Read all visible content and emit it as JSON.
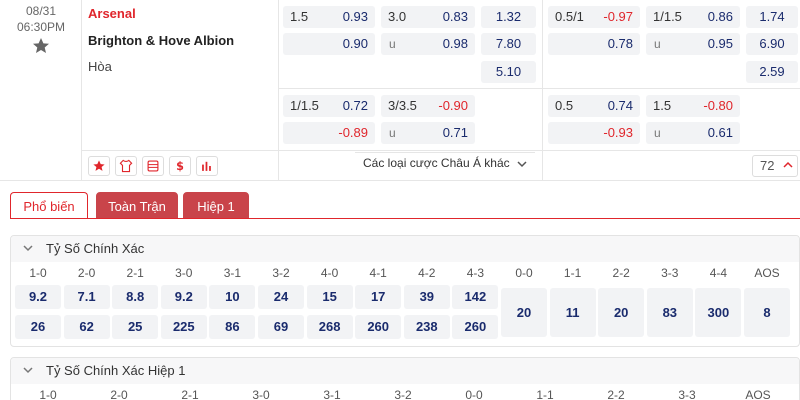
{
  "match": {
    "date": "08/31",
    "time": "06:30PM",
    "home_team": "Arsenal",
    "away_team": "Brighton & Hove Albion",
    "draw_label": "Hòa"
  },
  "odds_rows": {
    "row1": {
      "hdp_line": "1.5",
      "hdp_home": "0.93",
      "ou_line": "3.0",
      "ou_over": "0.83",
      "x12_home": "1.32",
      "h1_hdp_line": "0.5/1",
      "h1_hdp_home": "-0.97",
      "h1_ou_line": "1/1.5",
      "h1_ou_over": "0.86",
      "h1_x12_home": "1.74"
    },
    "row2": {
      "hdp_away": "0.90",
      "ou_u": "u",
      "ou_under": "0.98",
      "x12_away": "7.80",
      "h1_hdp_away": "0.78",
      "h1_ou_u": "u",
      "h1_ou_under": "0.95",
      "h1_x12_away": "6.90"
    },
    "row3": {
      "x12_draw": "5.10",
      "h1_x12_draw": "2.59"
    },
    "alt1": {
      "hdp_line": "1/1.5",
      "hdp_home": "0.72",
      "ou_line": "3/3.5",
      "ou_over": "-0.90",
      "h1_hdp_line": "0.5",
      "h1_hdp_home": "0.74",
      "h1_ou_line": "1.5",
      "h1_ou_over": "-0.80"
    },
    "alt2": {
      "hdp_away": "-0.89",
      "ou_u": "u",
      "ou_under": "0.71",
      "h1_hdp_away": "-0.93",
      "h1_ou_u": "u",
      "h1_ou_under": "0.61"
    }
  },
  "toolbar": {
    "icons": [
      "star-icon",
      "jersey-icon",
      "stats-icon",
      "dollar-icon",
      "chart-icon"
    ],
    "more_bets_label": "Các loại cược Châu Á khác",
    "market_count": "72"
  },
  "tabs": [
    {
      "label": "Phổ biến",
      "active": true
    },
    {
      "label": "Toàn Trận",
      "active": false
    },
    {
      "label": "Hiệp 1",
      "active": false
    }
  ],
  "correct_score": {
    "title": "Tỷ Số Chính Xác",
    "headers": [
      "1-0",
      "2-0",
      "2-1",
      "3-0",
      "3-1",
      "3-2",
      "4-0",
      "4-1",
      "4-2",
      "4-3",
      "0-0",
      "1-1",
      "2-2",
      "3-3",
      "4-4",
      "AOS"
    ],
    "home_odds": [
      "9.2",
      "7.1",
      "8.8",
      "9.2",
      "10",
      "24",
      "15",
      "17",
      "39",
      "142"
    ],
    "away_odds": [
      "26",
      "62",
      "25",
      "225",
      "86",
      "69",
      "268",
      "260",
      "238",
      "260"
    ],
    "draw_odds": [
      "20",
      "11",
      "20",
      "83",
      "300",
      "8"
    ]
  },
  "correct_score_h1": {
    "title": "Tỷ Số Chính Xác Hiệp 1",
    "headers": [
      "1-0",
      "2-0",
      "2-1",
      "3-0",
      "3-1",
      "3-2",
      "0-0",
      "1-1",
      "2-2",
      "3-3",
      "AOS"
    ]
  },
  "colors": {
    "accent": "#e0262c",
    "odds_blue": "#1a2b6d",
    "tab_red": "#c9444a"
  }
}
